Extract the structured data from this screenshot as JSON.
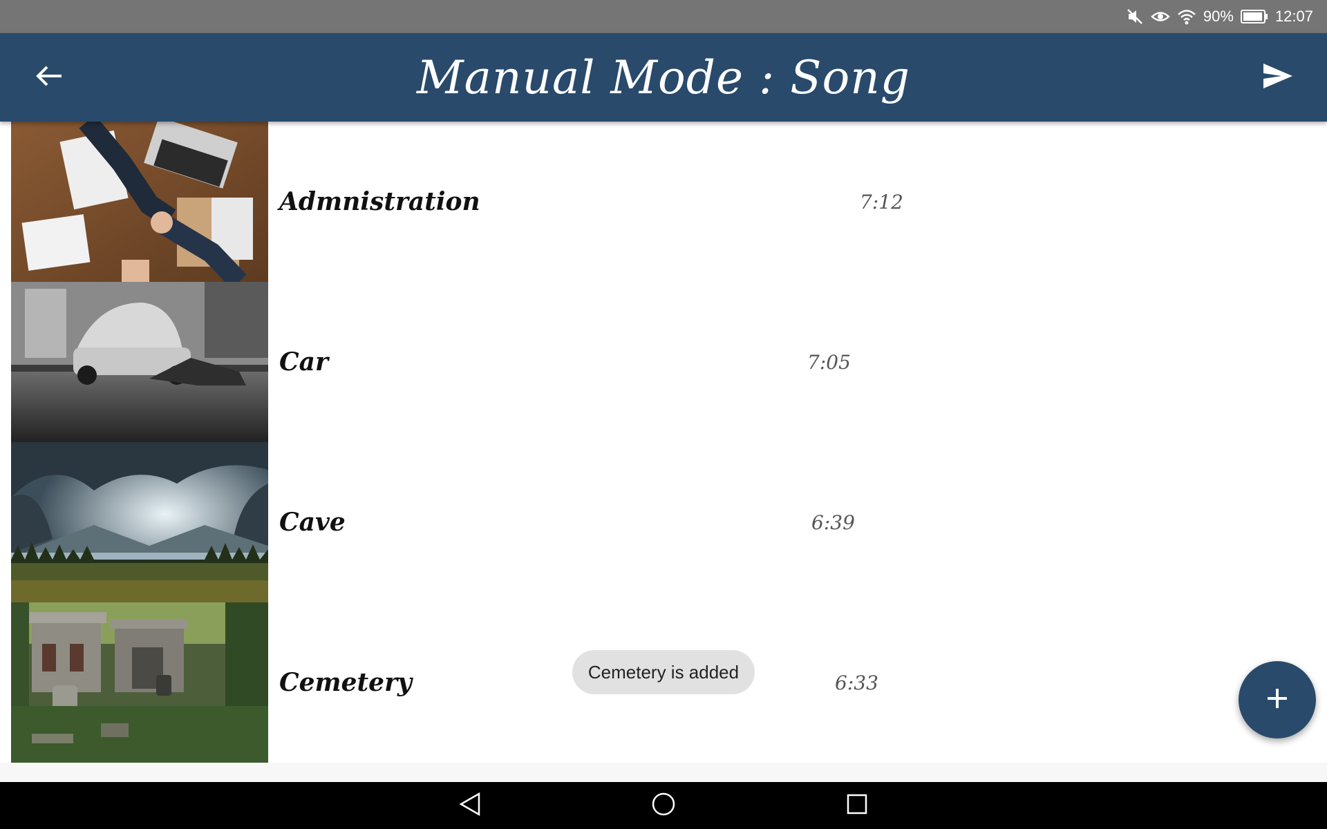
{
  "status_bar": {
    "battery": "90%",
    "time": "12:07",
    "icons": [
      "mute-icon",
      "eye-comfort-icon",
      "wifi-icon",
      "battery-icon"
    ]
  },
  "app_bar": {
    "title": "Manual Mode : Song",
    "back_icon": "arrow-left-icon",
    "send_icon": "send-icon",
    "color": "#294a6b"
  },
  "songs": [
    {
      "name": "Admnistration",
      "duration": "7:12",
      "image": "handshake-desk-photo"
    },
    {
      "name": "Car",
      "duration": "7:05",
      "image": "car-garage-photo"
    },
    {
      "name": "Cave",
      "duration": "6:39",
      "image": "cave-landscape-photo"
    },
    {
      "name": "Cemetery",
      "duration": "6:33",
      "image": "cemetery-photo"
    }
  ],
  "toast": {
    "message": "Cemetery is added"
  },
  "fab": {
    "icon": "plus-icon"
  },
  "nav_bar": {
    "icons": [
      "nav-back-icon",
      "nav-home-icon",
      "nav-recents-icon"
    ]
  }
}
